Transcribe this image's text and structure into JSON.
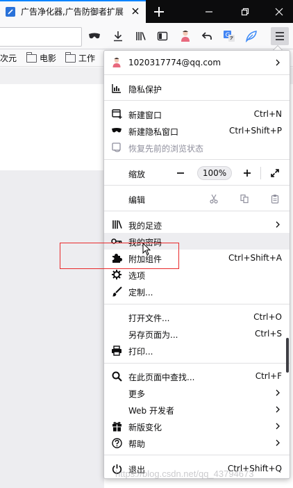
{
  "tab": {
    "title": "广告净化器,广告防御者扩展"
  },
  "bookmarks": {
    "items": [
      "次元",
      "电影",
      "工作"
    ]
  },
  "account": {
    "email": "1020317774@qq.com"
  },
  "menu": {
    "privacy": "隐私保护",
    "new_window": {
      "label": "新建窗口",
      "shortcut": "Ctrl+N"
    },
    "new_private": {
      "label": "新建隐私窗口",
      "shortcut": "Ctrl+Shift+P"
    },
    "restore": {
      "label": "恢复先前的浏览状态"
    },
    "zoom": {
      "label": "缩放",
      "minus": "—",
      "value": "100%",
      "plus": "+"
    },
    "edit": {
      "label": "编辑"
    },
    "library": {
      "label": "我的足迹"
    },
    "passwords": {
      "label": "我的密码"
    },
    "addons": {
      "label": "附加组件",
      "shortcut": "Ctrl+Shift+A"
    },
    "options": {
      "label": "选项"
    },
    "customize": {
      "label": "定制..."
    },
    "open_file": {
      "label": "打开文件...",
      "shortcut": "Ctrl+O"
    },
    "save_page": {
      "label": "另存页面为...",
      "shortcut": "Ctrl+S"
    },
    "print": {
      "label": "打印..."
    },
    "find": {
      "label": "在此页面中查找...",
      "shortcut": "Ctrl+F"
    },
    "more": {
      "label": "更多"
    },
    "webdev": {
      "label": "Web 开发者"
    },
    "whats_new": {
      "label": "新版变化"
    },
    "help": {
      "label": "帮助"
    },
    "quit": {
      "label": "退出",
      "shortcut": "Ctrl+Shift+Q"
    }
  },
  "watermark": "https://blog.csdn.net/qq_43794673",
  "colors": {
    "accent": "#0a84ff",
    "highlight": "#e8282a",
    "hover": "#ededf0"
  }
}
